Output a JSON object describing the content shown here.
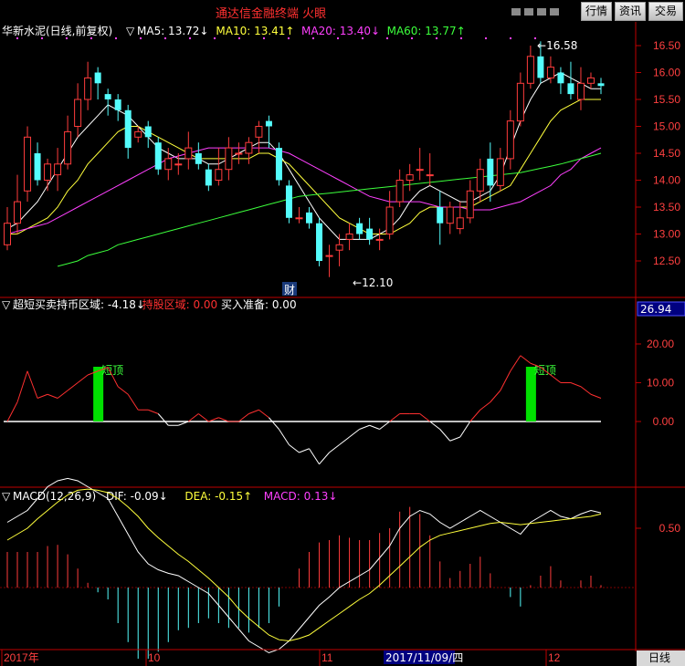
{
  "app": {
    "title": "通达信金融终端 火眼",
    "buttons": [
      "行情",
      "资讯",
      "交易"
    ]
  },
  "stock": {
    "name": "华新水泥(日线,前复权)",
    "ma": [
      {
        "label": "MA5: 13.72",
        "arrow": "↓",
        "color": "#ffffff"
      },
      {
        "label": "MA10: 13.41",
        "arrow": "↑",
        "color": "#ffff3c"
      },
      {
        "label": "MA20: 13.40",
        "arrow": "↓",
        "color": "#ff40ff"
      },
      {
        "label": "MA60: 13.77",
        "arrow": "↑",
        "color": "#3cff3c"
      }
    ],
    "high_mark": "16.58",
    "low_mark": "12.10",
    "finance_tag": "财",
    "price_axis": [
      "16.50",
      "16.00",
      "15.50",
      "15.00",
      "14.50",
      "14.00",
      "13.50",
      "13.00",
      "12.50"
    ]
  },
  "indicator1": {
    "name": "超短买卖",
    "items": [
      {
        "label": "持币区域: -4.18",
        "arrow": "↓",
        "color": "#ffffff"
      },
      {
        "label": "持股区域: 0.00",
        "arrow": "",
        "color": "#ff3030"
      },
      {
        "label": "买入准备: 0.00",
        "arrow": "",
        "color": "#ffffff"
      }
    ],
    "value_box": "26.94",
    "axis": [
      "20.00",
      "10.00",
      "0.00"
    ],
    "signal_label": "短顶"
  },
  "indicator2": {
    "name": "MACD(12,26,9)",
    "items": [
      {
        "label": "DIF: -0.09",
        "arrow": "↓",
        "color": "#ffffff"
      },
      {
        "label": "DEA: -0.15",
        "arrow": "↑",
        "color": "#ffff3c"
      },
      {
        "label": "MACD: 0.13",
        "arrow": "↓",
        "color": "#ff40ff"
      }
    ],
    "axis": [
      "0.50"
    ]
  },
  "timeline": {
    "labels": [
      "2017年",
      "10",
      "11",
      "12"
    ],
    "cursor_date": "2017/11/09/四",
    "period": "日线"
  },
  "chart_data": {
    "type": "candlestick",
    "price_range": [
      12.1,
      16.6
    ],
    "candles": [
      [
        12.8,
        13.2,
        13.5,
        12.7
      ],
      [
        13.2,
        13.6,
        14.1,
        13.0
      ],
      [
        13.8,
        14.8,
        15.0,
        13.6
      ],
      [
        14.5,
        14.0,
        14.7,
        13.9
      ],
      [
        14.0,
        14.3,
        14.4,
        13.8
      ],
      [
        14.1,
        14.3,
        14.6,
        13.8
      ],
      [
        14.3,
        14.9,
        15.2,
        14.2
      ],
      [
        15.0,
        15.5,
        15.8,
        14.8
      ],
      [
        15.5,
        15.9,
        16.2,
        15.3
      ],
      [
        16.0,
        15.8,
        16.1,
        15.5
      ],
      [
        15.6,
        15.5,
        15.7,
        15.2
      ],
      [
        15.5,
        15.3,
        15.6,
        15.1
      ],
      [
        15.3,
        14.6,
        15.4,
        14.4
      ],
      [
        14.8,
        14.9,
        15.0,
        14.7
      ],
      [
        15.0,
        14.8,
        15.1,
        14.6
      ],
      [
        14.7,
        14.2,
        14.8,
        14.1
      ],
      [
        14.2,
        14.4,
        14.6,
        14.0
      ],
      [
        14.3,
        14.3,
        14.5,
        14.1
      ],
      [
        14.4,
        14.6,
        14.9,
        14.2
      ],
      [
        14.5,
        14.3,
        14.7,
        14.2
      ],
      [
        14.2,
        13.9,
        14.3,
        13.8
      ],
      [
        14.0,
        14.2,
        14.6,
        13.9
      ],
      [
        14.2,
        14.6,
        14.8,
        14.0
      ],
      [
        14.5,
        14.5,
        14.7,
        14.3
      ],
      [
        14.5,
        14.7,
        14.8,
        14.3
      ],
      [
        14.8,
        15.0,
        15.1,
        14.5
      ],
      [
        15.1,
        15.0,
        15.2,
        14.6
      ],
      [
        14.6,
        14.0,
        14.7,
        13.9
      ],
      [
        13.9,
        13.3,
        14.0,
        13.2
      ],
      [
        13.3,
        13.3,
        13.5,
        13.2
      ],
      [
        13.4,
        13.2,
        13.5,
        13.1
      ],
      [
        13.2,
        12.5,
        13.3,
        12.4
      ],
      [
        12.6,
        12.6,
        12.8,
        12.2
      ],
      [
        12.7,
        12.8,
        13.0,
        12.4
      ],
      [
        12.9,
        13.0,
        13.2,
        12.7
      ],
      [
        13.2,
        13.0,
        13.3,
        12.9
      ],
      [
        13.1,
        12.9,
        13.3,
        12.8
      ],
      [
        12.9,
        12.9,
        13.1,
        12.7
      ],
      [
        13.0,
        13.5,
        13.8,
        12.9
      ],
      [
        13.6,
        14.0,
        14.2,
        13.5
      ],
      [
        14.0,
        14.1,
        14.3,
        13.8
      ],
      [
        14.2,
        14.2,
        14.6,
        14.0
      ],
      [
        14.1,
        14.1,
        14.5,
        13.9
      ],
      [
        13.5,
        13.2,
        13.8,
        12.8
      ],
      [
        13.2,
        13.5,
        13.6,
        13.0
      ],
      [
        13.1,
        13.3,
        13.6,
        13.0
      ],
      [
        13.3,
        13.8,
        14.0,
        13.2
      ],
      [
        13.8,
        14.2,
        14.4,
        13.6
      ],
      [
        14.4,
        13.9,
        14.7,
        13.6
      ],
      [
        13.9,
        14.4,
        14.6,
        13.8
      ],
      [
        14.4,
        15.1,
        15.3,
        14.2
      ],
      [
        15.1,
        15.8,
        16.0,
        15.0
      ],
      [
        15.8,
        16.3,
        16.5,
        15.7
      ],
      [
        16.3,
        15.9,
        16.58,
        15.8
      ],
      [
        15.9,
        16.1,
        16.3,
        15.8
      ],
      [
        16.0,
        15.8,
        16.1,
        15.6
      ],
      [
        15.8,
        15.6,
        16.2,
        15.5
      ],
      [
        15.5,
        15.8,
        16.1,
        15.3
      ],
      [
        15.8,
        15.9,
        16.0,
        15.7
      ],
      [
        15.8,
        15.75,
        15.9,
        15.6
      ]
    ],
    "ma_series": [
      {
        "name": "MA5",
        "color": "#ffffff",
        "values": [
          13.1,
          13.2,
          13.4,
          13.6,
          13.9,
          14.2,
          14.5,
          14.8,
          15.0,
          15.2,
          15.4,
          15.3,
          15.2,
          15.0,
          14.8,
          14.6,
          14.5,
          14.4,
          14.4,
          14.4,
          14.3,
          14.3,
          14.4,
          14.5,
          14.6,
          14.7,
          14.7,
          14.5,
          14.2,
          13.9,
          13.6,
          13.3,
          13.1,
          12.9,
          12.9,
          12.9,
          12.9,
          13.0,
          13.1,
          13.3,
          13.6,
          13.8,
          13.9,
          13.8,
          13.7,
          13.6,
          13.6,
          13.7,
          13.8,
          14.1,
          14.6,
          15.1,
          15.5,
          15.8,
          15.9,
          16.0,
          15.9,
          15.8,
          15.7,
          15.7
        ]
      },
      {
        "name": "MA10",
        "color": "#ffff3c",
        "values": [
          13.0,
          13.0,
          13.1,
          13.2,
          13.3,
          13.5,
          13.8,
          14.0,
          14.3,
          14.5,
          14.7,
          14.9,
          15.0,
          15.0,
          14.9,
          14.8,
          14.7,
          14.6,
          14.5,
          14.4,
          14.4,
          14.4,
          14.4,
          14.4,
          14.4,
          14.5,
          14.5,
          14.4,
          14.3,
          14.1,
          13.9,
          13.7,
          13.5,
          13.3,
          13.2,
          13.1,
          13.0,
          13.0,
          13.0,
          13.1,
          13.2,
          13.4,
          13.5,
          13.5,
          13.5,
          13.5,
          13.5,
          13.6,
          13.7,
          13.8,
          13.9,
          14.2,
          14.5,
          14.8,
          15.1,
          15.3,
          15.4,
          15.5,
          15.5,
          15.5
        ]
      },
      {
        "name": "MA20",
        "color": "#ff40ff",
        "values": [
          13.0,
          13.05,
          13.1,
          13.15,
          13.2,
          13.3,
          13.4,
          13.5,
          13.6,
          13.7,
          13.8,
          13.9,
          14.0,
          14.1,
          14.2,
          14.3,
          14.4,
          14.45,
          14.5,
          14.55,
          14.6,
          14.6,
          14.6,
          14.6,
          14.6,
          14.6,
          14.6,
          14.55,
          14.5,
          14.4,
          14.3,
          14.2,
          14.1,
          14.0,
          13.9,
          13.8,
          13.7,
          13.65,
          13.6,
          13.6,
          13.6,
          13.6,
          13.55,
          13.5,
          13.5,
          13.5,
          13.45,
          13.45,
          13.45,
          13.5,
          13.55,
          13.6,
          13.7,
          13.8,
          13.9,
          14.1,
          14.2,
          14.4,
          14.5,
          14.6
        ]
      },
      {
        "name": "MA60",
        "color": "#3cff3c",
        "values": [
          null,
          null,
          null,
          null,
          null,
          12.4,
          12.45,
          12.5,
          12.6,
          12.65,
          12.7,
          12.8,
          12.85,
          12.9,
          12.95,
          13.0,
          13.05,
          13.1,
          13.15,
          13.2,
          13.25,
          13.3,
          13.35,
          13.4,
          13.45,
          13.5,
          13.55,
          13.6,
          13.65,
          13.7,
          13.72,
          13.74,
          13.76,
          13.78,
          13.8,
          13.82,
          13.84,
          13.86,
          13.88,
          13.9,
          13.92,
          13.94,
          13.96,
          13.98,
          14.0,
          14.02,
          14.04,
          14.06,
          14.08,
          14.1,
          14.12,
          14.14,
          14.18,
          14.22,
          14.26,
          14.3,
          14.35,
          14.4,
          14.45,
          14.5
        ]
      }
    ],
    "ccb_series": {
      "name": "超短买卖",
      "values": [
        0,
        5,
        13,
        6,
        7,
        6,
        8,
        10,
        12,
        13,
        14,
        9,
        7,
        3,
        3,
        2,
        -1,
        -1,
        0,
        2,
        0,
        1,
        0,
        0,
        2,
        3,
        1,
        -2,
        -6,
        -8,
        -7,
        -11,
        -8,
        -6,
        -4,
        -2,
        -1,
        -2,
        0,
        2,
        2,
        2,
        0,
        -2,
        -5,
        -4,
        0,
        3,
        5,
        8,
        13,
        17,
        15,
        14,
        12,
        10,
        10,
        9,
        7,
        6
      ]
    },
    "macd": {
      "dif": [
        0.55,
        0.6,
        0.65,
        0.75,
        0.85,
        0.9,
        0.92,
        0.9,
        0.85,
        0.8,
        0.75,
        0.6,
        0.45,
        0.3,
        0.2,
        0.15,
        0.12,
        0.1,
        0.05,
        0.0,
        -0.05,
        -0.15,
        -0.25,
        -0.35,
        -0.45,
        -0.5,
        -0.55,
        -0.52,
        -0.45,
        -0.35,
        -0.25,
        -0.15,
        -0.08,
        0.0,
        0.05,
        0.1,
        0.15,
        0.25,
        0.35,
        0.5,
        0.6,
        0.65,
        0.62,
        0.55,
        0.5,
        0.55,
        0.6,
        0.65,
        0.6,
        0.55,
        0.5,
        0.45,
        0.55,
        0.6,
        0.65,
        0.6,
        0.58,
        0.62,
        0.65,
        0.63
      ],
      "dea": [
        0.4,
        0.45,
        0.5,
        0.58,
        0.65,
        0.72,
        0.78,
        0.82,
        0.83,
        0.82,
        0.8,
        0.75,
        0.68,
        0.6,
        0.5,
        0.42,
        0.35,
        0.28,
        0.22,
        0.15,
        0.08,
        0.0,
        -0.08,
        -0.18,
        -0.26,
        -0.33,
        -0.4,
        -0.44,
        -0.45,
        -0.43,
        -0.4,
        -0.34,
        -0.28,
        -0.22,
        -0.16,
        -0.1,
        -0.05,
        0.02,
        0.1,
        0.18,
        0.26,
        0.34,
        0.4,
        0.44,
        0.46,
        0.48,
        0.5,
        0.52,
        0.54,
        0.55,
        0.54,
        0.53,
        0.54,
        0.55,
        0.56,
        0.57,
        0.58,
        0.59,
        0.6,
        0.62
      ],
      "hist": [
        0.3,
        0.3,
        0.3,
        0.3,
        0.35,
        0.36,
        0.28,
        0.16,
        0.04,
        -0.04,
        -0.1,
        -0.3,
        -0.46,
        -0.6,
        -0.6,
        -0.54,
        -0.46,
        -0.36,
        -0.34,
        -0.3,
        -0.26,
        -0.3,
        -0.34,
        -0.34,
        -0.38,
        -0.34,
        -0.3,
        -0.16,
        0.0,
        0.16,
        0.3,
        0.38,
        0.4,
        0.44,
        0.42,
        0.4,
        0.4,
        0.46,
        0.5,
        0.64,
        0.68,
        0.62,
        0.44,
        0.22,
        0.08,
        0.14,
        0.2,
        0.26,
        0.12,
        0.0,
        -0.08,
        -0.16,
        0.02,
        0.1,
        0.18,
        0.06,
        0.0,
        0.06,
        0.1,
        0.02
      ]
    }
  }
}
